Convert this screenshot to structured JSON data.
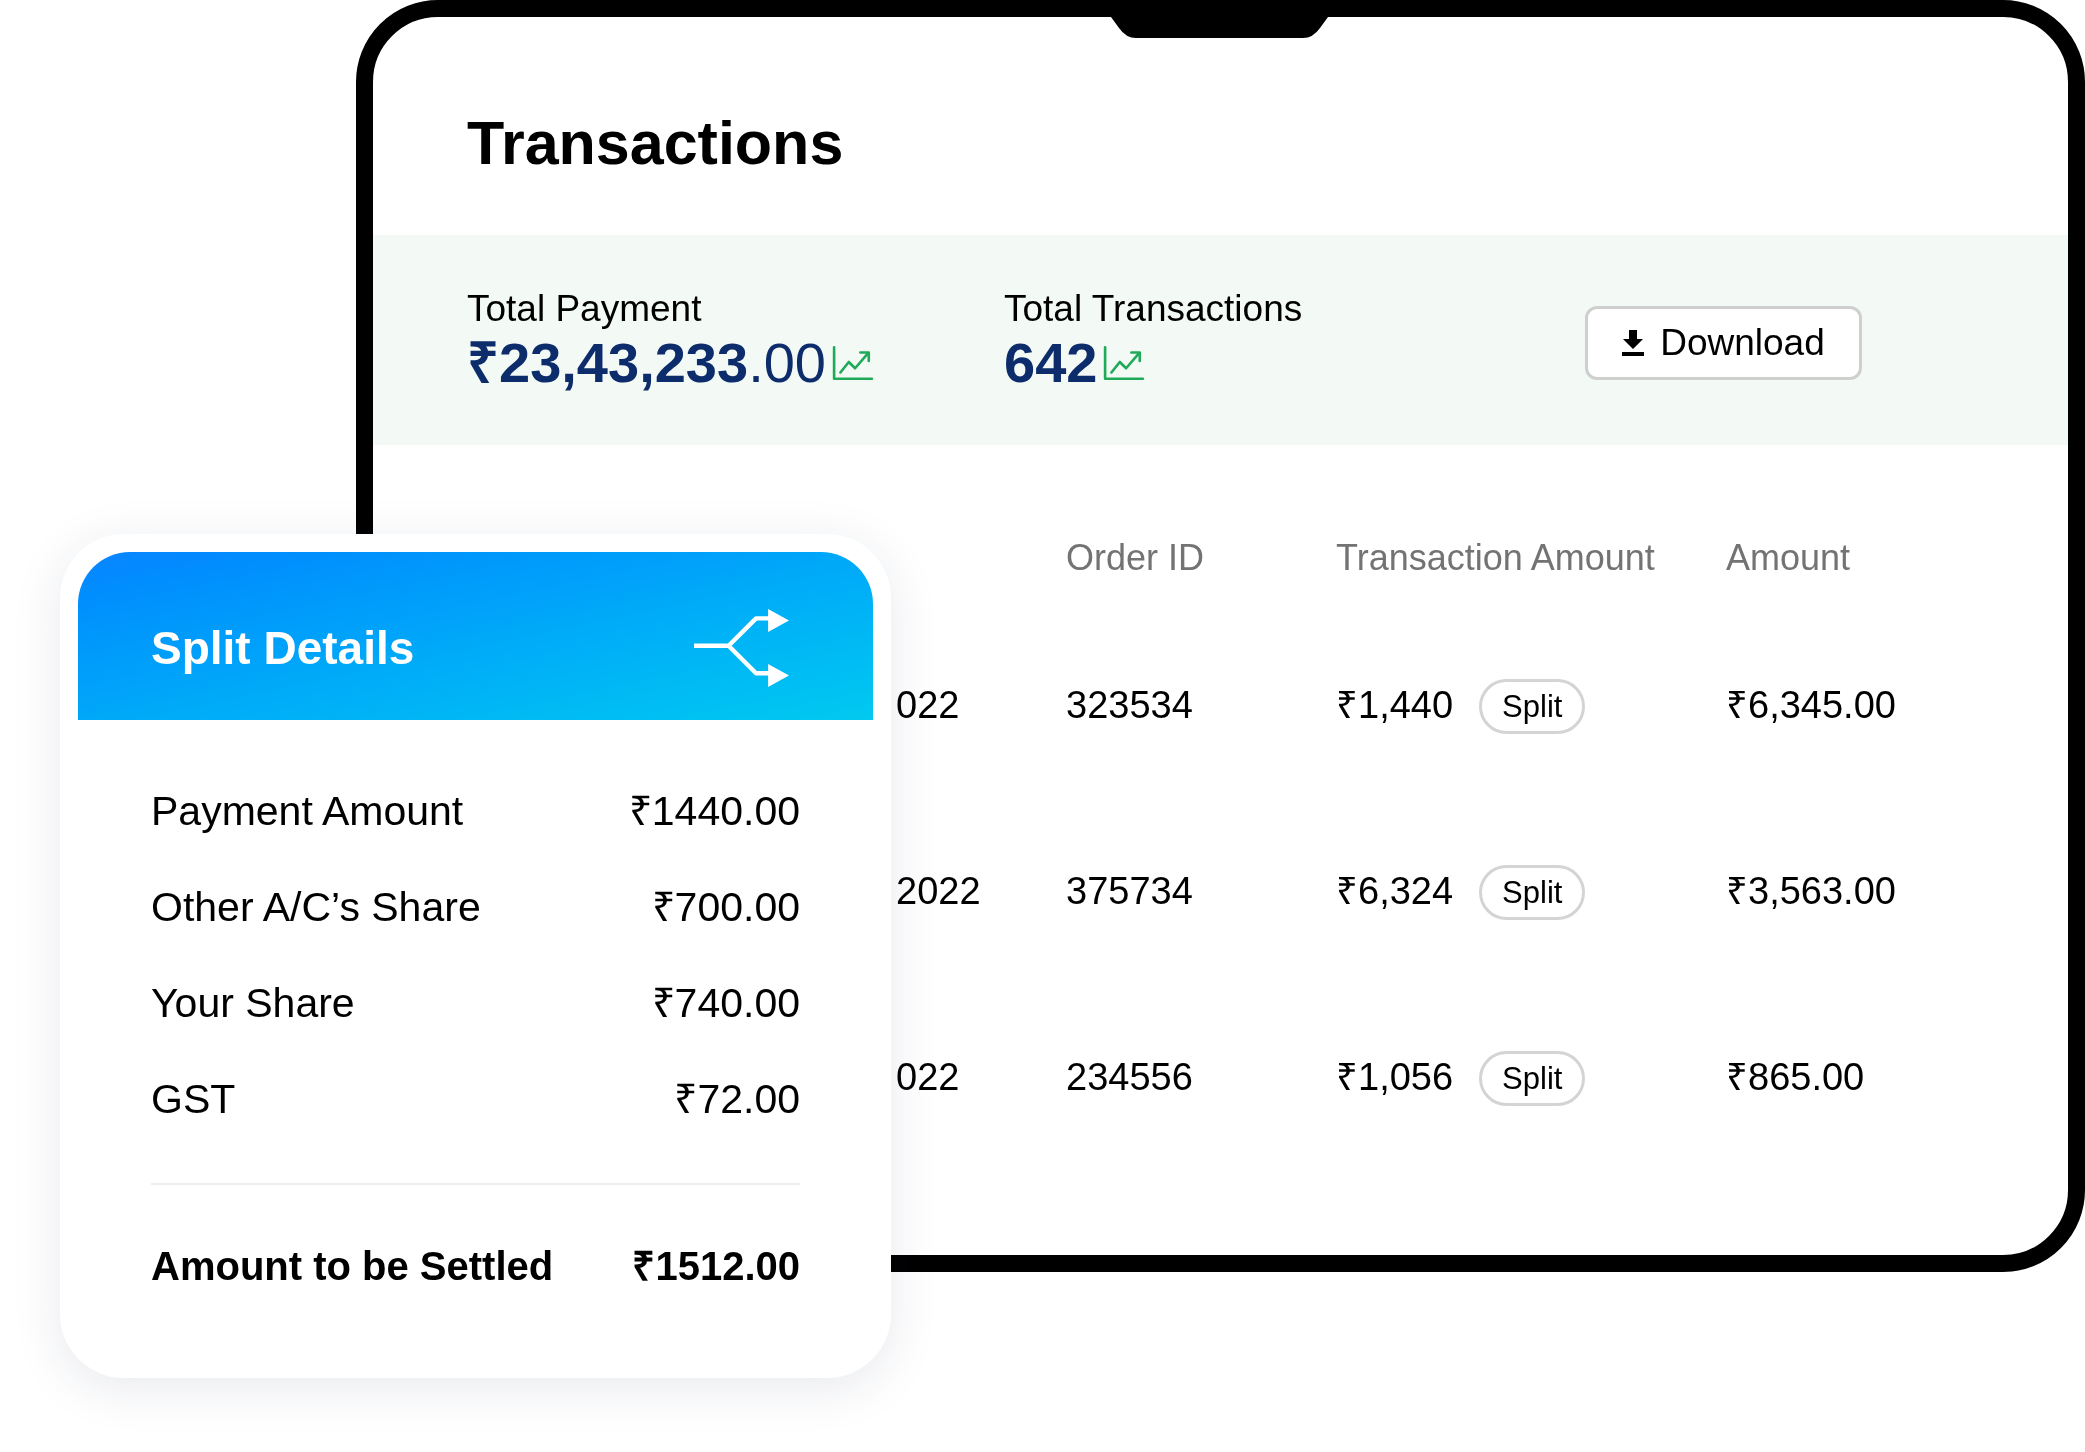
{
  "window": {
    "title": "Transactions"
  },
  "summary": {
    "stats": [
      {
        "kind": "currency",
        "label": "Total Payment",
        "value": "**₹23,43,233**.00"
      },
      {
        "kind": "count",
        "label": "Total Transactions",
        "value": "642"
      }
    ],
    "download_button": {
      "label": "Download"
    }
  },
  "table": {
    "columns": [
      "Order ID",
      "Transaction Amount",
      "Amount"
    ],
    "rows": [
      {
        "column_1": "022",
        "order_id": "323534",
        "transaction_amount": "₹1,440",
        "action": "Split",
        "amount": "₹6,345.00"
      },
      {
        "column_1": "2022",
        "order_id": "375734",
        "transaction_amount": "₹6,324",
        "action": "Split",
        "amount": "₹3,563.00"
      },
      {
        "column_1": "022",
        "order_id": "234556",
        "transaction_amount": "₹1,056",
        "action": "Split",
        "amount": "₹865.00"
      }
    ]
  },
  "split_details": {
    "title": "Split Details",
    "rows": [
      {
        "label": "Payment Amount",
        "value": "₹1440.00"
      },
      {
        "label": "Other A/C’s Share",
        "value": "₹700.00"
      },
      {
        "label": "Your Share",
        "value": "₹740.00"
      },
      {
        "label": "GST",
        "value": "₹72.00"
      }
    ],
    "total": {
      "label": "Amount to be Settled",
      "value": "₹1512.00"
    }
  }
}
